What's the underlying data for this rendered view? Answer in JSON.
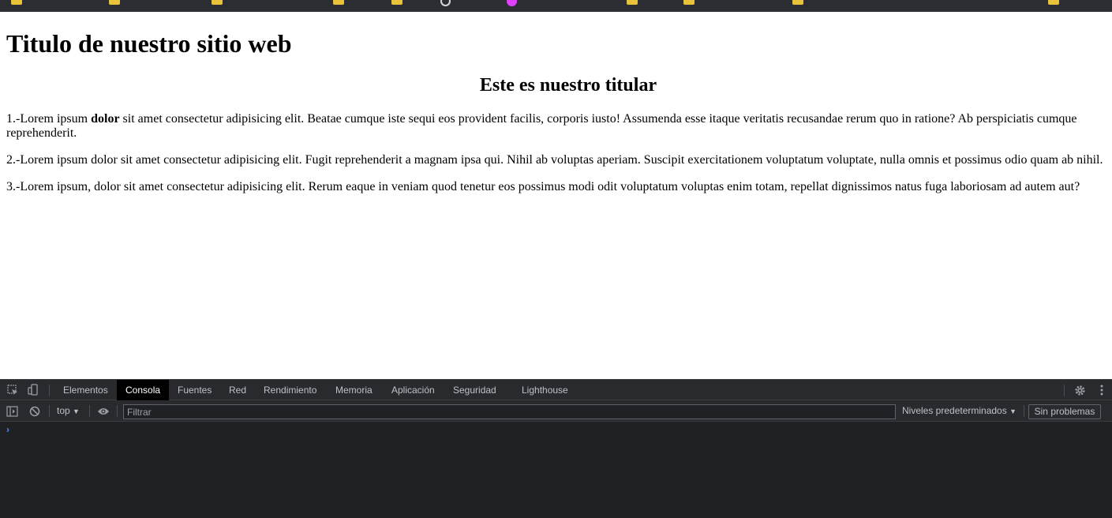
{
  "page": {
    "title": "Titulo de nuestro sitio web",
    "headline": "Este es nuestro titular",
    "paragraphs": [
      {
        "before": "1.-Lorem ipsum ",
        "bold": "dolor",
        "after": " sit amet consectetur adipisicing elit. Beatae cumque iste sequi eos provident facilis, corporis iusto! Assumenda esse itaque veritatis recusandae rerum quo in ratione? Ab perspiciatis cumque reprehenderit."
      },
      {
        "text": "2.-Lorem ipsum dolor sit amet consectetur adipisicing elit. Fugit reprehenderit a magnam ipsa qui. Nihil ab voluptas aperiam. Suscipit exercitationem voluptatum voluptate, nulla omnis et possimus odio quam ab nihil."
      },
      {
        "text": "3.-Lorem ipsum, dolor sit amet consectetur adipisicing elit. Rerum eaque in veniam quod tenetur eos possimus modi odit voluptatum voluptas enim totam, repellat dignissimos natus fuga laboriosam ad autem aut?"
      }
    ]
  },
  "devtools": {
    "tabs": [
      "Elementos",
      "Consola",
      "Fuentes",
      "Red",
      "Rendimiento",
      "Memoria",
      "Aplicación",
      "Seguridad",
      "Lighthouse"
    ],
    "active_tab": "Consola",
    "context": "top",
    "filter_placeholder": "Filtrar",
    "levels_label": "Niveles predeterminados",
    "issues_label": "Sin problemas",
    "prompt_symbol": "›",
    "icons": {
      "inspect": "inspect-element-icon",
      "device": "device-toolbar-icon",
      "sidebar": "show-sidebar-icon",
      "clear": "clear-console-icon",
      "eye": "live-expression-icon",
      "settings": "gear-icon",
      "menu": "more-options-icon"
    },
    "colors": {
      "panel_bg": "#202124",
      "toolbar_bg": "#292a2d",
      "active_tab_bg": "#000000",
      "prompt": "#4d8fe6"
    }
  },
  "bookmarks": {
    "folder_color": "#e8c33a",
    "favicon_color": "#e040fb"
  }
}
